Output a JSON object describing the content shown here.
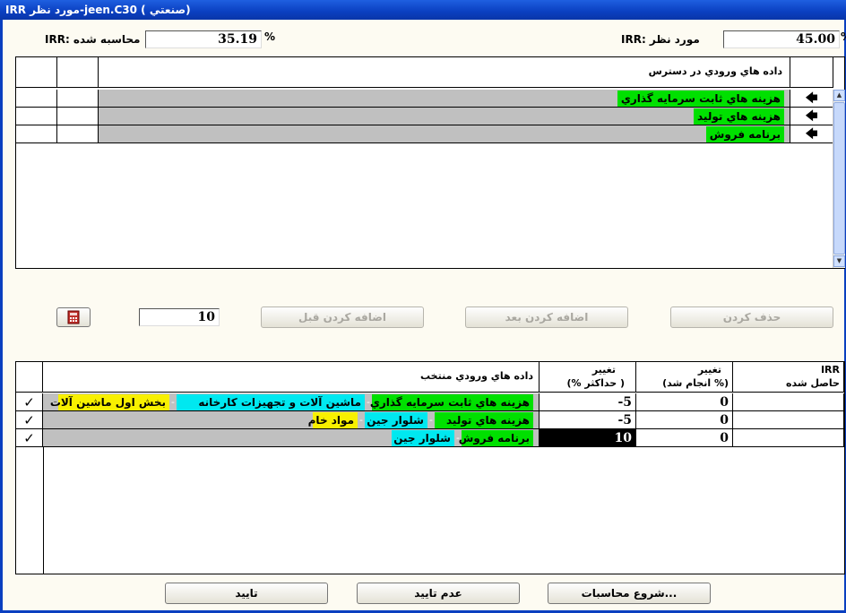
{
  "window": {
    "title": "IRR مورد نظر-jeen.C30 ( صنعتي)"
  },
  "top": {
    "target_label": "IRR: مورد نظر",
    "target_value": "45.00",
    "target_unit": "%",
    "calc_label": "IRR: محاسبه شده",
    "calc_value": "35.19",
    "calc_unit": "%"
  },
  "available": {
    "header": "داده هاي ورودي در دسترس",
    "rows": [
      {
        "label": "هزينه هاي ثابت سرمايه گذاري"
      },
      {
        "label": "هزينه هاي توليد"
      },
      {
        "label": "برنامه فروش"
      }
    ],
    "arrow_glyph": "🡄"
  },
  "controls": {
    "calculator_icon": "calculator-icon",
    "step_value": "10",
    "add_before": "اضافه كردن قبل",
    "add_after": "اضافه كردن بعد",
    "delete": "حذف كردن"
  },
  "selected": {
    "headers": {
      "inputs": "داده هاي ورودي منتخب",
      "change_max_1": "تغيير",
      "change_max_2": "( حداكثر %)",
      "change_done_1": "تغيير",
      "change_done_2": "(% انجام شد)",
      "irr_1": "IRR",
      "irr_2": "حاصل شده"
    },
    "rows": [
      {
        "tags": [
          "هزينه هاي ثابت سرمايه گذاري",
          "ماشين آلات و تجهيزات كارخانه",
          "بخش اول ماشين آلات"
        ],
        "max_change": "-5",
        "done_change": "0",
        "irr": "",
        "checked": "✓"
      },
      {
        "tags": [
          "هزينه هاي توليد",
          "شلوار جين",
          "مواد خام"
        ],
        "max_change": "-5",
        "done_change": "0",
        "irr": "",
        "checked": "✓"
      },
      {
        "tags": [
          "برنامه فروش",
          "شلوار جين"
        ],
        "max_change": "10",
        "done_change": "0",
        "irr": "",
        "checked": "✓"
      }
    ]
  },
  "footer": {
    "start": "شروع محاسبات...",
    "reject": "عدم تاييد",
    "confirm": "تاييد"
  },
  "colors": {
    "green": "#00e000",
    "cyan": "#00e8f0",
    "yellow": "#f8f000",
    "gray": "#c0c0c0",
    "title_blue": "#0a3fc0"
  }
}
